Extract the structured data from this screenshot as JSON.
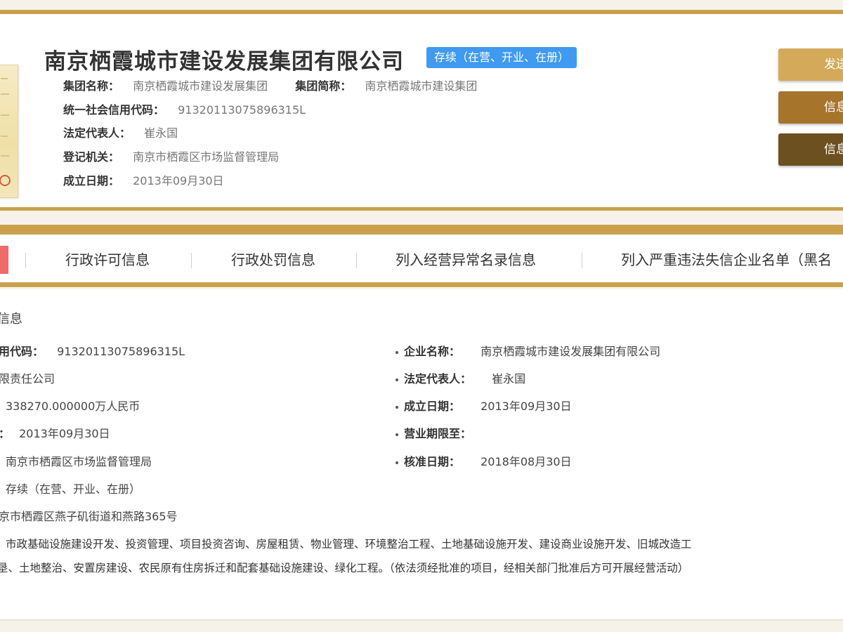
{
  "header": {
    "company_name": "南京栖霞城市建设发展集团有限公司",
    "status_badge": "存续（在营、开业、在册）",
    "group_name_label": "集团名称：",
    "group_name_value": "南京栖霞城市建设发展集团",
    "group_short_label": "集团简称：",
    "group_short_value": "南京栖霞城市建设集团",
    "credit_code_label": "统一社会信用代码：",
    "credit_code_value": "91320113075896315L",
    "legal_rep_label": "法定代表人：",
    "legal_rep_value": "崔永国",
    "reg_authority_label": "登记机关：",
    "reg_authority_value": "南京市栖霞区市场监督管理局",
    "established_label": "成立日期：",
    "established_value": "2013年09月30日"
  },
  "side_buttons": [
    {
      "label": "发送"
    },
    {
      "label": "信息"
    },
    {
      "label": "信息"
    }
  ],
  "tabs": [
    {
      "label": "行政许可信息"
    },
    {
      "label": "行政处罚信息"
    },
    {
      "label": "列入经营异常名录信息"
    },
    {
      "label": "列入严重违法失信企业名单（黑名"
    }
  ],
  "details": {
    "section_title": "信息",
    "left": [
      {
        "label": "用代码：",
        "value": "91320113075896315L"
      },
      {
        "label": "",
        "value": "限责任公司"
      },
      {
        "label": "",
        "value": "338270.000000万人民币"
      },
      {
        "label": "：",
        "value": "2013年09月30日"
      },
      {
        "label": "",
        "value": "南京市栖霞区市场监督管理局"
      },
      {
        "label": "",
        "value": "存续（在营、开业、在册）"
      },
      {
        "label": "",
        "value": "京市栖霞区燕子矶街道和燕路365号"
      }
    ],
    "right": [
      {
        "label": "企业名称：",
        "value": "南京栖霞城市建设发展集团有限公司"
      },
      {
        "label": "法定代表人：",
        "value": "崔永国"
      },
      {
        "label": "成立日期：",
        "value": "2013年09月30日"
      },
      {
        "label": "营业期限至：",
        "value": ""
      },
      {
        "label": "核准日期：",
        "value": "2018年08月30日"
      }
    ],
    "scope_line1": "市政基础设施建设开发、投资管理、项目投资咨询、房屋租赁、物业管理、环境整治工程、土地基础设施开发、建设商业设施开发、旧城改造工",
    "scope_line2": "垦、土地整治、安置房建设、农民原有住房拆迁和配套基础设施建设、绿化工程。（依法须经批准的项目，经相关部门批准后方可开展经营活动）"
  },
  "colors": {
    "gold": "#c9a04b",
    "status_blue": "#3f9af0",
    "active_tab": "#ef6a6a"
  }
}
